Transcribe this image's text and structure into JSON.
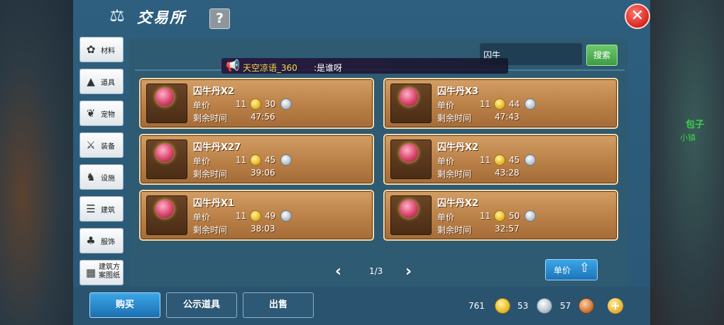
{
  "window": {
    "title": "交易所",
    "help_label": "?",
    "close_label": "✕"
  },
  "background": {
    "side_label": "包子",
    "side_label2": "小镇"
  },
  "categories": [
    {
      "label": "材料",
      "icon": "materials-icon",
      "glyph": "✿"
    },
    {
      "label": "道具",
      "icon": "item-icon",
      "glyph": "▲"
    },
    {
      "label": "宠物",
      "icon": "paw-icon",
      "glyph": "❦"
    },
    {
      "label": "装备",
      "icon": "sword-icon",
      "glyph": "⚔"
    },
    {
      "label": "设施",
      "icon": "facility-icon",
      "glyph": "♞"
    },
    {
      "label": "建筑",
      "icon": "building-icon",
      "glyph": "☰"
    },
    {
      "label": "服饰",
      "icon": "clothing-icon",
      "glyph": "♣"
    },
    {
      "label": "建筑方案图纸",
      "icon": "blueprint-icon",
      "glyph": "▦"
    }
  ],
  "search": {
    "value": "囚牛",
    "button_label": "搜索"
  },
  "message": {
    "user": "天空凉语_360",
    "text": ":是谁呀"
  },
  "listings": [
    {
      "name": "囚牛丹X2",
      "price_label": "单价",
      "gold": "11",
      "silver": "30",
      "time_label": "剩余时间",
      "time": "47:56"
    },
    {
      "name": "囚牛丹X3",
      "price_label": "单价",
      "gold": "11",
      "silver": "44",
      "time_label": "剩余时间",
      "time": "47:43"
    },
    {
      "name": "囚牛丹X27",
      "price_label": "单价",
      "gold": "11",
      "silver": "45",
      "time_label": "剩余时间",
      "time": "39:06"
    },
    {
      "name": "囚牛丹X2",
      "price_label": "单价",
      "gold": "11",
      "silver": "45",
      "time_label": "剩余时间",
      "time": "43:28"
    },
    {
      "name": "囚牛丹X1",
      "price_label": "单价",
      "gold": "11",
      "silver": "49",
      "time_label": "剩余时间",
      "time": "38:03"
    },
    {
      "name": "囚牛丹X2",
      "price_label": "单价",
      "gold": "11",
      "silver": "50",
      "time_label": "剩余时间",
      "time": "32:57"
    }
  ],
  "pager": {
    "text": "1/3",
    "prev": "‹",
    "next": "›"
  },
  "sort": {
    "label": "单价",
    "icon": "sort-up-icon"
  },
  "bottom": {
    "buy_label": "购买",
    "public_label": "公示道具",
    "sell_label": "出售"
  },
  "currency": {
    "gold": "761",
    "silver": "53",
    "copper": "57"
  },
  "colors": {
    "accent": "#1e74b7",
    "card": "#b77d45",
    "panel": "#2e5f7e"
  }
}
